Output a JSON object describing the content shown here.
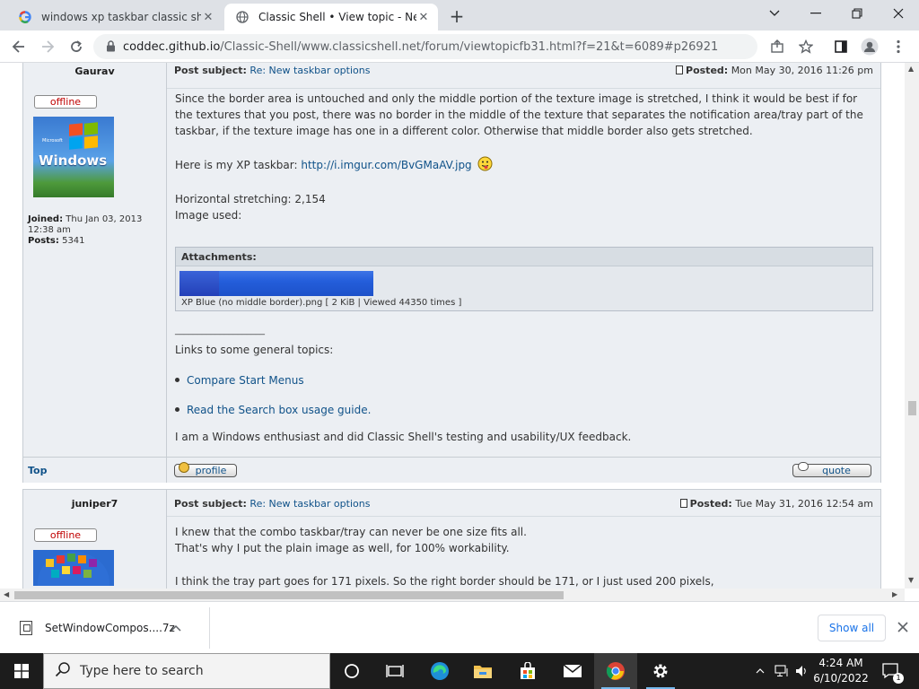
{
  "browser": {
    "tabs": [
      {
        "title": "windows xp taskbar classic shell - Google Search",
        "active": false
      },
      {
        "title": "Classic Shell • View topic - New taskbar options",
        "active": true
      }
    ],
    "url_host": "coddec.github.io",
    "url_path": "/Classic-Shell/www.classicshell.net/forum/viewtopicfb31.html?f=21&t=6089#p26921"
  },
  "posts": [
    {
      "author": "Gaurav",
      "status": "offline",
      "avatar_caption_small": "Microsoft",
      "avatar_caption": "Windows",
      "joined_label": "Joined:",
      "joined_value": "Thu Jan 03, 2013 12:38 am",
      "posts_label": "Posts:",
      "posts_value": "5341",
      "subject_label": "Post subject:",
      "subject_link": "Re: New taskbar options",
      "posted_label": "Posted:",
      "posted_value": "Mon May 30, 2016 11:26 pm",
      "paragraph_1": "Since the border area is untouched and only the middle portion of the texture image is stretched, I think it would be best if for the textures that you post, there was no border in the middle of the texture that separates the notification area/tray part of the taskbar, if the texture image has one in a different color. Otherwise that middle border also gets stretched.",
      "xp_taskbar_prefix": "Here is my XP taskbar:",
      "xp_taskbar_link": "http://i.imgur.com/BvGMaAV.jpg",
      "stretch_line": "Horizontal stretching: 2,154",
      "image_used": "Image used:",
      "attachments_label": "Attachments:",
      "attachment_caption": "XP Blue (no middle border).png [ 2 KiB | Viewed 44350 times ]",
      "sig_rule": "____________________",
      "sig_links_label": "Links to some general topics:",
      "sig_link_1": "Compare Start Menus",
      "sig_link_2": "Read the Search box usage guide.",
      "sig_note": "I am a Windows enthusiast and did Classic Shell's testing and usability/UX feedback.",
      "top_link": "Top",
      "profile_btn": "profile",
      "quote_btn": "quote"
    },
    {
      "author": "juniper7",
      "status": "offline",
      "subject_label": "Post subject:",
      "subject_link": "Re: New taskbar options",
      "posted_label": "Posted:",
      "posted_value": "Tue May 31, 2016 12:54 am",
      "line_1": "I knew that the combo taskbar/tray can never be one size fits all.",
      "line_2": "That's why I put the plain image as well, for 100% workability.",
      "line_3": "I think the tray part goes for 171 pixels. So the right border should be 171, or I just used 200 pixels,"
    }
  ],
  "downloads": {
    "file_name": "SetWindowCompos....7z",
    "show_all": "Show all"
  },
  "taskbar": {
    "search_placeholder": "Type here to search",
    "time": "4:24 AM",
    "date": "6/10/2022",
    "notification_count": "1"
  }
}
